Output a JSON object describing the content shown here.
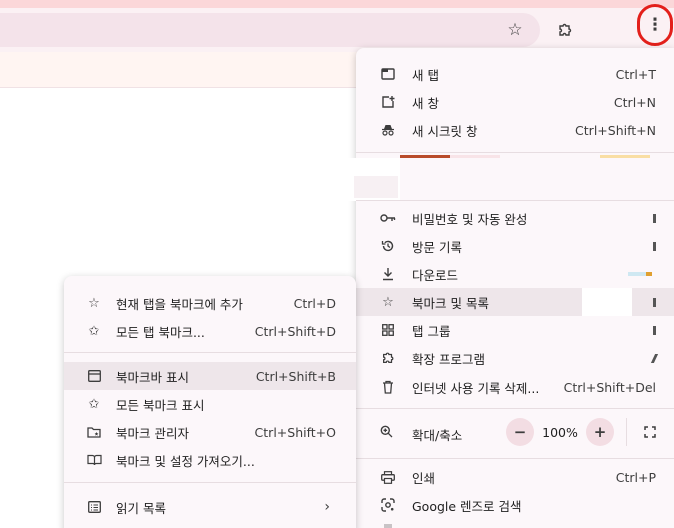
{
  "toolbar": {
    "star_icon": "bookmark-star-icon",
    "extensions_icon": "puzzle-icon",
    "menu_icon": "kebab-menu-icon",
    "menu_glyph": "⋮"
  },
  "main_menu": {
    "new_tab": {
      "label": "새 탭",
      "shortcut": "Ctrl+T"
    },
    "new_window": {
      "label": "새 창",
      "shortcut": "Ctrl+N"
    },
    "new_incognito": {
      "label": "새 시크릿 창",
      "shortcut": "Ctrl+Shift+N"
    },
    "passwords": {
      "label": "비밀번호 및 자동 완성"
    },
    "history": {
      "label": "방문 기록"
    },
    "downloads": {
      "label": "다운로드"
    },
    "bookmarks": {
      "label": "북마크 및 목록"
    },
    "tab_groups": {
      "label": "탭 그룹"
    },
    "extensions": {
      "label": "확장 프로그램"
    },
    "clear_data": {
      "label": "인터넷 사용 기록 삭제...",
      "shortcut": "Ctrl+Shift+Del"
    },
    "zoom": {
      "label": "확대/축소",
      "minus": "−",
      "plus": "+",
      "value": "100%"
    },
    "print": {
      "label": "인쇄",
      "shortcut": "Ctrl+P"
    },
    "lens": {
      "label": "Google 렌즈로 검색"
    }
  },
  "bookmark_submenu": {
    "add_bookmark": {
      "label": "현재 탭을 북마크에 추가",
      "shortcut": "Ctrl+D"
    },
    "bookmark_all": {
      "label": "모든 탭 북마크...",
      "shortcut": "Ctrl+Shift+D"
    },
    "show_bar": {
      "label": "북마크바 표시",
      "shortcut": "Ctrl+Shift+B"
    },
    "show_all": {
      "label": "모든 북마크 표시"
    },
    "manager": {
      "label": "북마크 관리자",
      "shortcut": "Ctrl+Shift+O"
    },
    "import": {
      "label": "북마크 및 설정 가져오기..."
    },
    "reading_list": {
      "label": "읽기 목록",
      "chevron": "›"
    }
  },
  "colors": {
    "accent_red": "#e3201b",
    "menu_bg": "#fcf7fa",
    "highlight": "#eee6ea"
  }
}
